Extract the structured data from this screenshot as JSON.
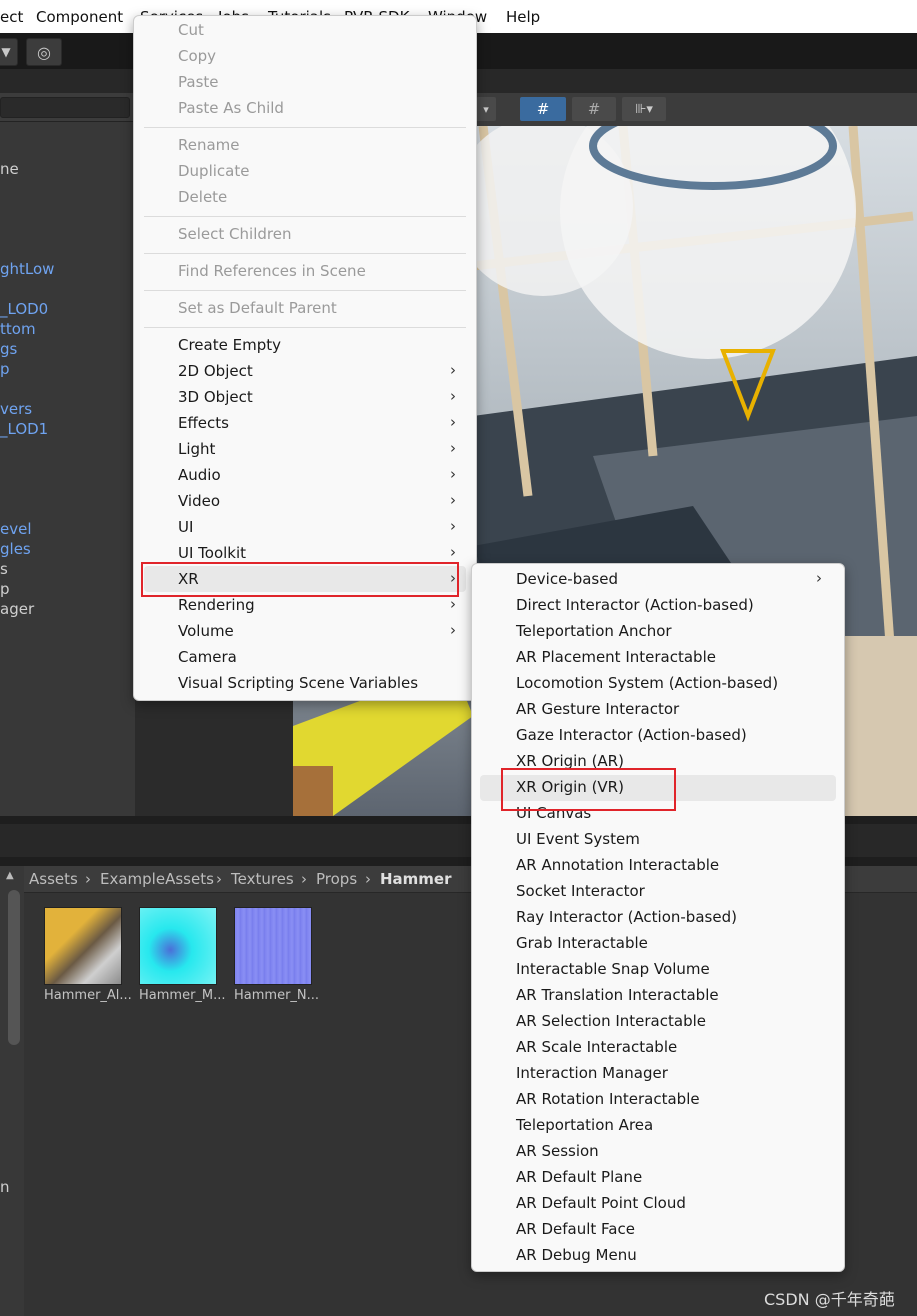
{
  "menubar": [
    "ect",
    "Component",
    "Services",
    "Jobs",
    "Tutorials",
    "PVR SDK",
    "Window",
    "Help"
  ],
  "toolbar": {
    "dropdown_glyph": "▼",
    "collab_glyph": "◎",
    "gizmo_glyph": "#",
    "arrow_glyph": "▾"
  },
  "hierarchy": {
    "items": [
      {
        "text": "ne",
        "color": "#cfcfcf"
      },
      {
        "text": "ghtLow",
        "color": "#6fa3f0"
      },
      {
        "text": "_LOD0",
        "color": "#6fa3f0"
      },
      {
        "text": "ttom",
        "color": "#6fa3f0"
      },
      {
        "text": "gs",
        "color": "#6fa3f0"
      },
      {
        "text": "p",
        "color": "#6fa3f0"
      },
      {
        "text": "vers",
        "color": "#6fa3f0"
      },
      {
        "text": "_LOD1",
        "color": "#6fa3f0"
      },
      {
        "text": "evel",
        "color": "#6fa3f0"
      },
      {
        "text": "gles",
        "color": "#6fa3f0"
      },
      {
        "text": "s",
        "color": "#cfcfcf"
      },
      {
        "text": "p",
        "color": "#cfcfcf"
      },
      {
        "text": "ager",
        "color": "#cfcfcf"
      },
      {
        "text": "n",
        "color": "#cfcfcf"
      }
    ]
  },
  "context_menu": {
    "items": [
      {
        "label": "Cut",
        "disabled": true
      },
      {
        "label": "Copy",
        "disabled": true
      },
      {
        "label": "Paste",
        "disabled": true
      },
      {
        "label": "Paste As Child",
        "disabled": true
      },
      {
        "label": "Rename",
        "disabled": true
      },
      {
        "label": "Duplicate",
        "disabled": true
      },
      {
        "label": "Delete",
        "disabled": true
      },
      {
        "label": "Select Children",
        "disabled": true
      },
      {
        "label": "Find References in Scene",
        "disabled": true
      },
      {
        "label": "Set as Default Parent",
        "disabled": true
      },
      {
        "label": "Create Empty",
        "disabled": false
      },
      {
        "label": "2D Object",
        "disabled": false,
        "submenu": true
      },
      {
        "label": "3D Object",
        "disabled": false,
        "submenu": true
      },
      {
        "label": "Effects",
        "disabled": false,
        "submenu": true
      },
      {
        "label": "Light",
        "disabled": false,
        "submenu": true
      },
      {
        "label": "Audio",
        "disabled": false,
        "submenu": true
      },
      {
        "label": "Video",
        "disabled": false,
        "submenu": true
      },
      {
        "label": "UI",
        "disabled": false,
        "submenu": true
      },
      {
        "label": "UI Toolkit",
        "disabled": false,
        "submenu": true
      },
      {
        "label": "XR",
        "disabled": false,
        "submenu": true,
        "selected": true
      },
      {
        "label": "Rendering",
        "disabled": false,
        "submenu": true
      },
      {
        "label": "Volume",
        "disabled": false,
        "submenu": true
      },
      {
        "label": "Camera",
        "disabled": false
      },
      {
        "label": "Visual Scripting Scene Variables",
        "disabled": false
      }
    ],
    "arrow": "›"
  },
  "xr_submenu": {
    "items": [
      {
        "label": "Device-based",
        "submenu": true
      },
      {
        "label": "Direct Interactor (Action-based)"
      },
      {
        "label": "Teleportation Anchor"
      },
      {
        "label": "AR Placement Interactable"
      },
      {
        "label": "Locomotion System (Action-based)"
      },
      {
        "label": "AR Gesture Interactor"
      },
      {
        "label": "Gaze Interactor (Action-based)"
      },
      {
        "label": "XR Origin (AR)"
      },
      {
        "label": "XR Origin (VR)",
        "hovered": true
      },
      {
        "label": "UI Canvas"
      },
      {
        "label": "UI Event System"
      },
      {
        "label": "AR Annotation Interactable"
      },
      {
        "label": "Socket Interactor"
      },
      {
        "label": "Ray Interactor (Action-based)"
      },
      {
        "label": "Grab Interactable"
      },
      {
        "label": "Interactable Snap Volume"
      },
      {
        "label": "AR Translation Interactable"
      },
      {
        "label": "AR Selection Interactable"
      },
      {
        "label": "AR Scale Interactable"
      },
      {
        "label": "Interaction Manager"
      },
      {
        "label": "AR Rotation Interactable"
      },
      {
        "label": "Teleportation Area"
      },
      {
        "label": "AR Session"
      },
      {
        "label": "AR Default Plane"
      },
      {
        "label": "AR Default Point Cloud"
      },
      {
        "label": "AR Default Face"
      },
      {
        "label": "AR Debug Menu"
      }
    ]
  },
  "project": {
    "breadcrumb": [
      "Assets",
      "ExampleAssets",
      "Textures",
      "Props",
      "Hammer"
    ],
    "separator": "›",
    "assets": [
      {
        "label": "Hammer_Al...",
        "color": "#c9a53a"
      },
      {
        "label": "Hammer_M...",
        "color": "#27e8ee"
      },
      {
        "label": "Hammer_N...",
        "color": "#7e83f0"
      }
    ]
  },
  "watermark": "CSDN @千年奇葩"
}
